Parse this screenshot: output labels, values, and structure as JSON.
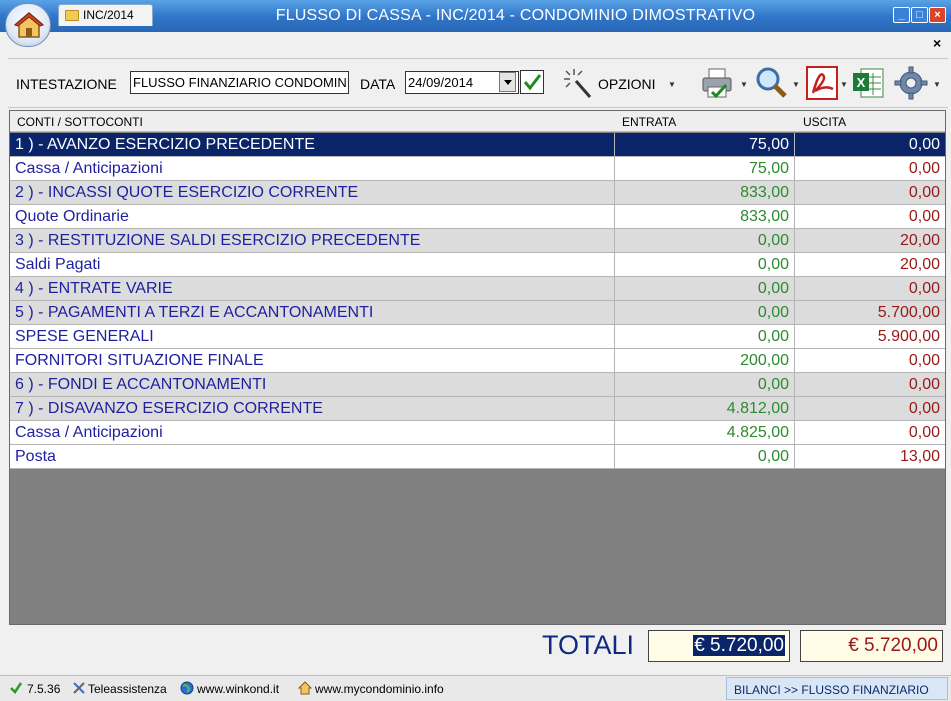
{
  "window": {
    "title": "FLUSSO DI CASSA - INC/2014 - CONDOMINIO DIMOSTRATIVO",
    "tab_label": "INC/2014",
    "close_x": "×"
  },
  "toolbar": {
    "intestazione_label": "INTESTAZIONE",
    "intestazione_value": "FLUSSO FINANZIARIO CONDOMINIO",
    "data_label": "DATA",
    "data_value": "24/09/2014",
    "opzioni_label": "OPZIONI"
  },
  "table": {
    "headers": [
      "CONTI / SOTTOCONTI",
      "ENTRATA",
      "USCITA"
    ],
    "rows": [
      {
        "label": "1 ) - AVANZO ESERCIZIO PRECEDENTE",
        "entrata": "75,00",
        "uscita": "0,00"
      },
      {
        "label": "Cassa / Anticipazioni",
        "entrata": "75,00",
        "uscita": "0,00"
      },
      {
        "label": "2 ) - INCASSI QUOTE ESERCIZIO CORRENTE",
        "entrata": "833,00",
        "uscita": "0,00"
      },
      {
        "label": "Quote Ordinarie",
        "entrata": "833,00",
        "uscita": "0,00"
      },
      {
        "label": "3 ) - RESTITUZIONE SALDI ESERCIZIO PRECEDENTE",
        "entrata": "0,00",
        "uscita": "20,00"
      },
      {
        "label": "Saldi Pagati",
        "entrata": "0,00",
        "uscita": "20,00"
      },
      {
        "label": "4 ) - ENTRATE VARIE",
        "entrata": "0,00",
        "uscita": "0,00"
      },
      {
        "label": "5 ) - PAGAMENTI A TERZI E ACCANTONAMENTI",
        "entrata": "0,00",
        "uscita": "5.700,00"
      },
      {
        "label": "SPESE GENERALI",
        "entrata": "0,00",
        "uscita": "5.900,00"
      },
      {
        "label": "FORNITORI SITUAZIONE FINALE",
        "entrata": "200,00",
        "uscita": "0,00"
      },
      {
        "label": "6 ) - FONDI E ACCANTONAMENTI",
        "entrata": "0,00",
        "uscita": "0,00"
      },
      {
        "label": "7 ) - DISAVANZO ESERCIZIO CORRENTE",
        "entrata": "4.812,00",
        "uscita": "0,00"
      },
      {
        "label": "Cassa / Anticipazioni",
        "entrata": "4.825,00",
        "uscita": "0,00"
      },
      {
        "label": "Posta",
        "entrata": "0,00",
        "uscita": "13,00"
      }
    ]
  },
  "totals": {
    "label": "TOTALI",
    "entrata": "€ 5.720,00",
    "uscita": "€ 5.720,00"
  },
  "statusbar": {
    "version": "7.5.36",
    "teleassistenza": "Teleassistenza",
    "site1": "www.winkond.it",
    "site2": "www.mycondominio.info",
    "breadcrumb": "BILANCI >> FLUSSO FINANZIARIO"
  },
  "colors": {
    "selected_row": "#0a246a",
    "group_row": "#dcdcdc",
    "entrata_text": "#2e8a2e",
    "uscita_text": "#9a1818",
    "label_text": "#1f1fa0"
  }
}
